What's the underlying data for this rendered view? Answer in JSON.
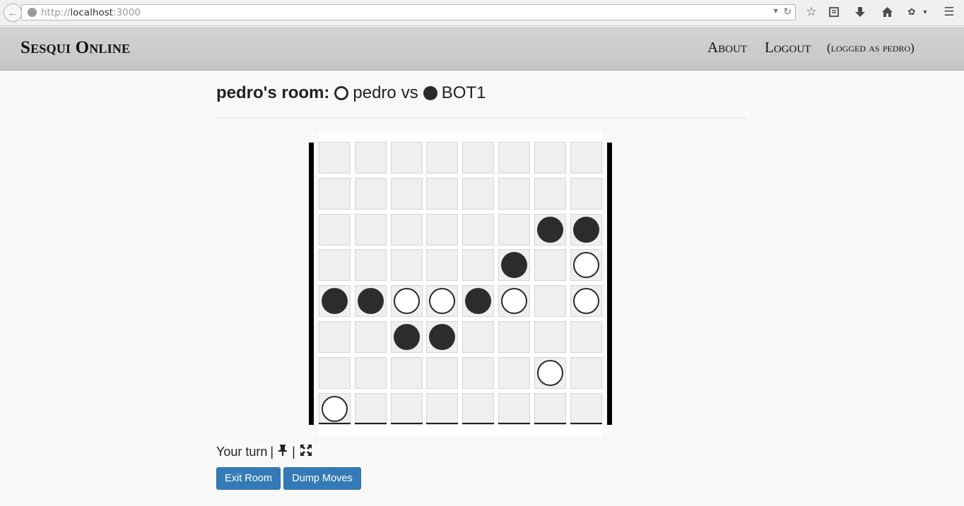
{
  "browser": {
    "url_prefix": "http://",
    "url_host": "localhost",
    "url_port": ":3000"
  },
  "navbar": {
    "brand": "Sesqui Online",
    "about_label": "About",
    "logout_label": "Logout",
    "login_status": "(logged as pedro)"
  },
  "room": {
    "owner_label": "pedro's room:",
    "player1": "pedro",
    "vs": "vs",
    "player2": "BOT1",
    "player1_color": "white",
    "player2_color": "black"
  },
  "board": {
    "size": 8,
    "rows": [
      [
        "",
        "",
        "",
        "",
        "",
        "",
        "",
        ""
      ],
      [
        "",
        "",
        "",
        "",
        "",
        "",
        "",
        ""
      ],
      [
        "",
        "",
        "",
        "",
        "",
        "",
        "B",
        "B"
      ],
      [
        "",
        "",
        "",
        "",
        "",
        "B",
        "",
        "W"
      ],
      [
        "B",
        "B",
        "W",
        "W",
        "B",
        "W",
        "",
        "W"
      ],
      [
        "",
        "",
        "B",
        "B",
        "",
        "",
        "",
        ""
      ],
      [
        "",
        "",
        "",
        "",
        "",
        "",
        "W",
        ""
      ],
      [
        "W",
        "",
        "",
        "",
        "",
        "",
        "",
        ""
      ]
    ]
  },
  "status": {
    "turn_text": "Your turn",
    "separator": "|"
  },
  "buttons": {
    "exit_room": "Exit Room",
    "dump_moves": "Dump Moves"
  },
  "colors": {
    "button_primary": "#337ab7",
    "piece_dark": "#2c2c2e",
    "cell_bg": "#efefef"
  }
}
